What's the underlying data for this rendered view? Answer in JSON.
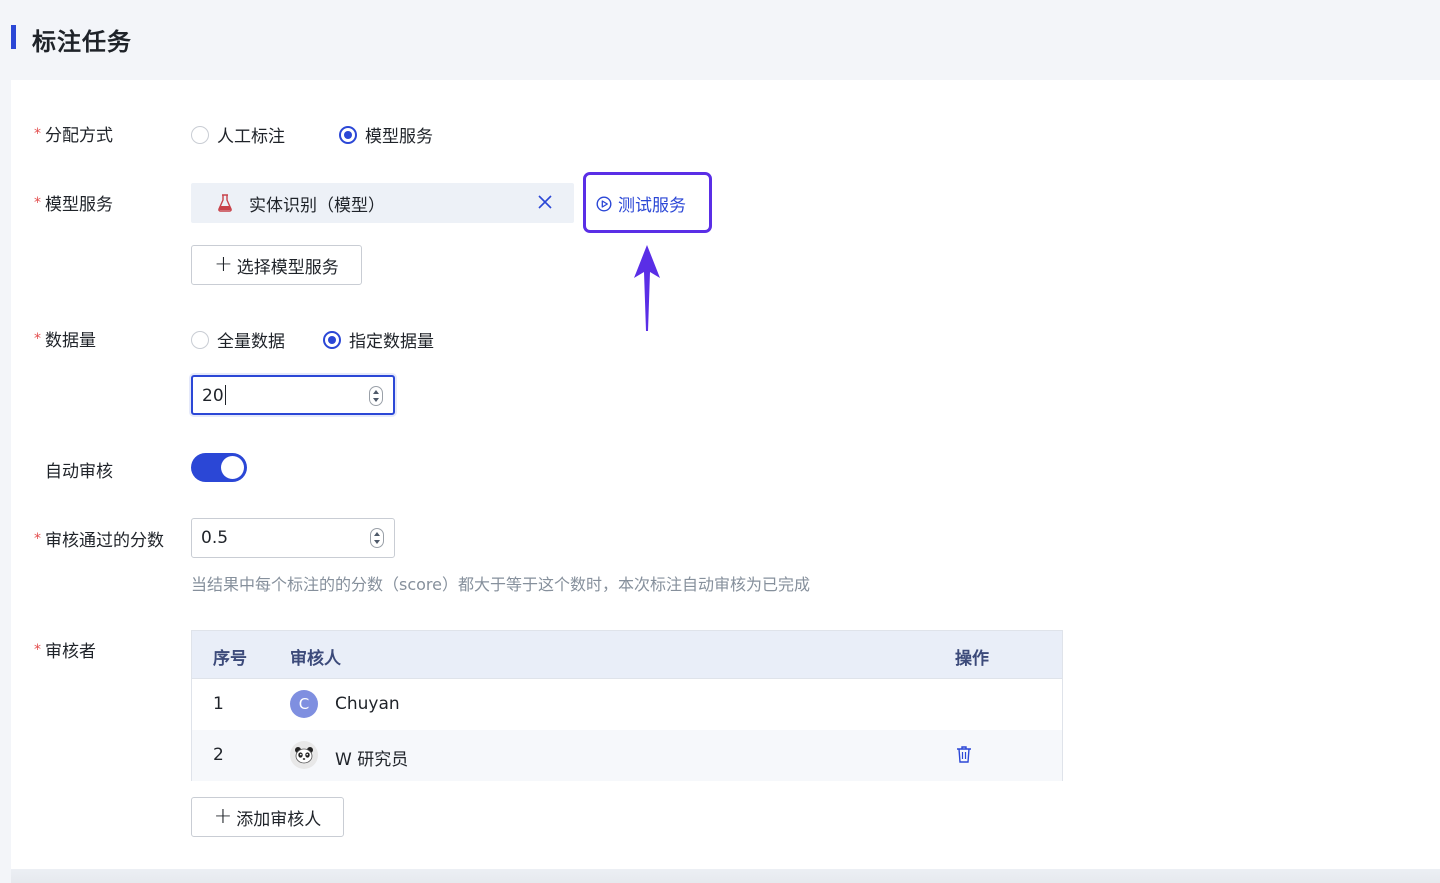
{
  "header": {
    "title": "标注任务"
  },
  "form": {
    "assign": {
      "label": "分配方式",
      "options": [
        "人工标注",
        "模型服务"
      ],
      "selected": "模型服务"
    },
    "model_service": {
      "label": "模型服务",
      "chip_label": "实体识别（模型）",
      "test_button": "测试服务",
      "select_button": "选择模型服务"
    },
    "data_volume": {
      "label": "数据量",
      "options": [
        "全量数据",
        "指定数据量"
      ],
      "selected": "指定数据量",
      "value": "20"
    },
    "auto_review": {
      "label": "自动审核",
      "enabled": true
    },
    "pass_score": {
      "label": "审核通过的分数",
      "value": "0.5",
      "hint": "当结果中每个标注的的分数（score）都大于等于这个数时，本次标注自动审核为已完成"
    },
    "reviewers": {
      "label": "审核者",
      "columns": [
        "序号",
        "审核人",
        "操作"
      ],
      "rows": [
        {
          "index": "1",
          "avatar_letter": "C",
          "name": "Chuyan"
        },
        {
          "index": "2",
          "avatar_icon": "panda-avatar-icon",
          "name": "W 研究员"
        }
      ],
      "add_button": "添加审核人"
    }
  },
  "colors": {
    "accent": "#2b47d6",
    "highlight": "#5a2ee6",
    "required": "#e34d4d"
  }
}
